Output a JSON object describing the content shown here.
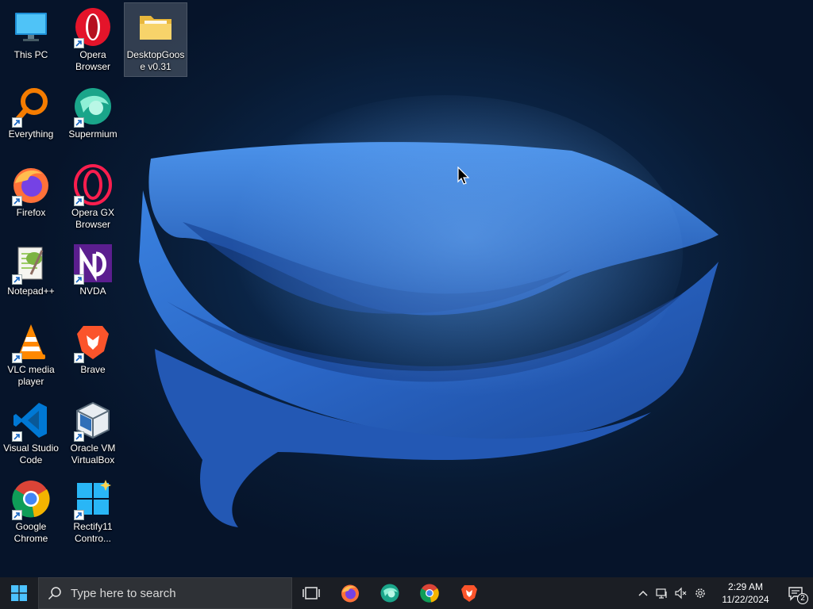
{
  "desktop": {
    "icons": [
      {
        "label": "This PC",
        "icon": "this-pc-icon"
      },
      {
        "label": "Opera Browser",
        "icon": "opera-icon"
      },
      {
        "label": "DesktopGoose v0.31",
        "icon": "folder-icon"
      },
      {
        "label": "Everything",
        "icon": "everything-search-icon"
      },
      {
        "label": "Supermium",
        "icon": "supermium-icon"
      },
      {
        "label": "Firefox",
        "icon": "firefox-icon"
      },
      {
        "label": "Opera GX Browser",
        "icon": "opera-gx-icon"
      },
      {
        "label": "Notepad++",
        "icon": "notepad-plus-plus-icon"
      },
      {
        "label": "NVDA",
        "icon": "nvda-icon"
      },
      {
        "label": "VLC media player",
        "icon": "vlc-icon"
      },
      {
        "label": "Brave",
        "icon": "brave-icon"
      },
      {
        "label": "Visual Studio Code",
        "icon": "vscode-icon"
      },
      {
        "label": "Oracle VM VirtualBox",
        "icon": "virtualbox-icon"
      },
      {
        "label": "Google Chrome",
        "icon": "chrome-icon"
      },
      {
        "label": "Rectify11 Contro...",
        "icon": "rectify11-icon"
      }
    ],
    "selected": "DesktopGoose v0.31"
  },
  "taskbar": {
    "search_placeholder": "Type here to search",
    "pinned_apps": [
      "firefox-icon",
      "supermium-icon",
      "chrome-icon",
      "brave-icon"
    ],
    "tray": {
      "time": "2:29 AM",
      "date": "11/22/2024",
      "notification_count": "2"
    }
  },
  "colors": {
    "taskbar_bg": "#1b1e24",
    "search_bg": "#2e3136",
    "wallpaper_dark": "#06142a",
    "wallpaper_blue": "#2f6fd0"
  }
}
